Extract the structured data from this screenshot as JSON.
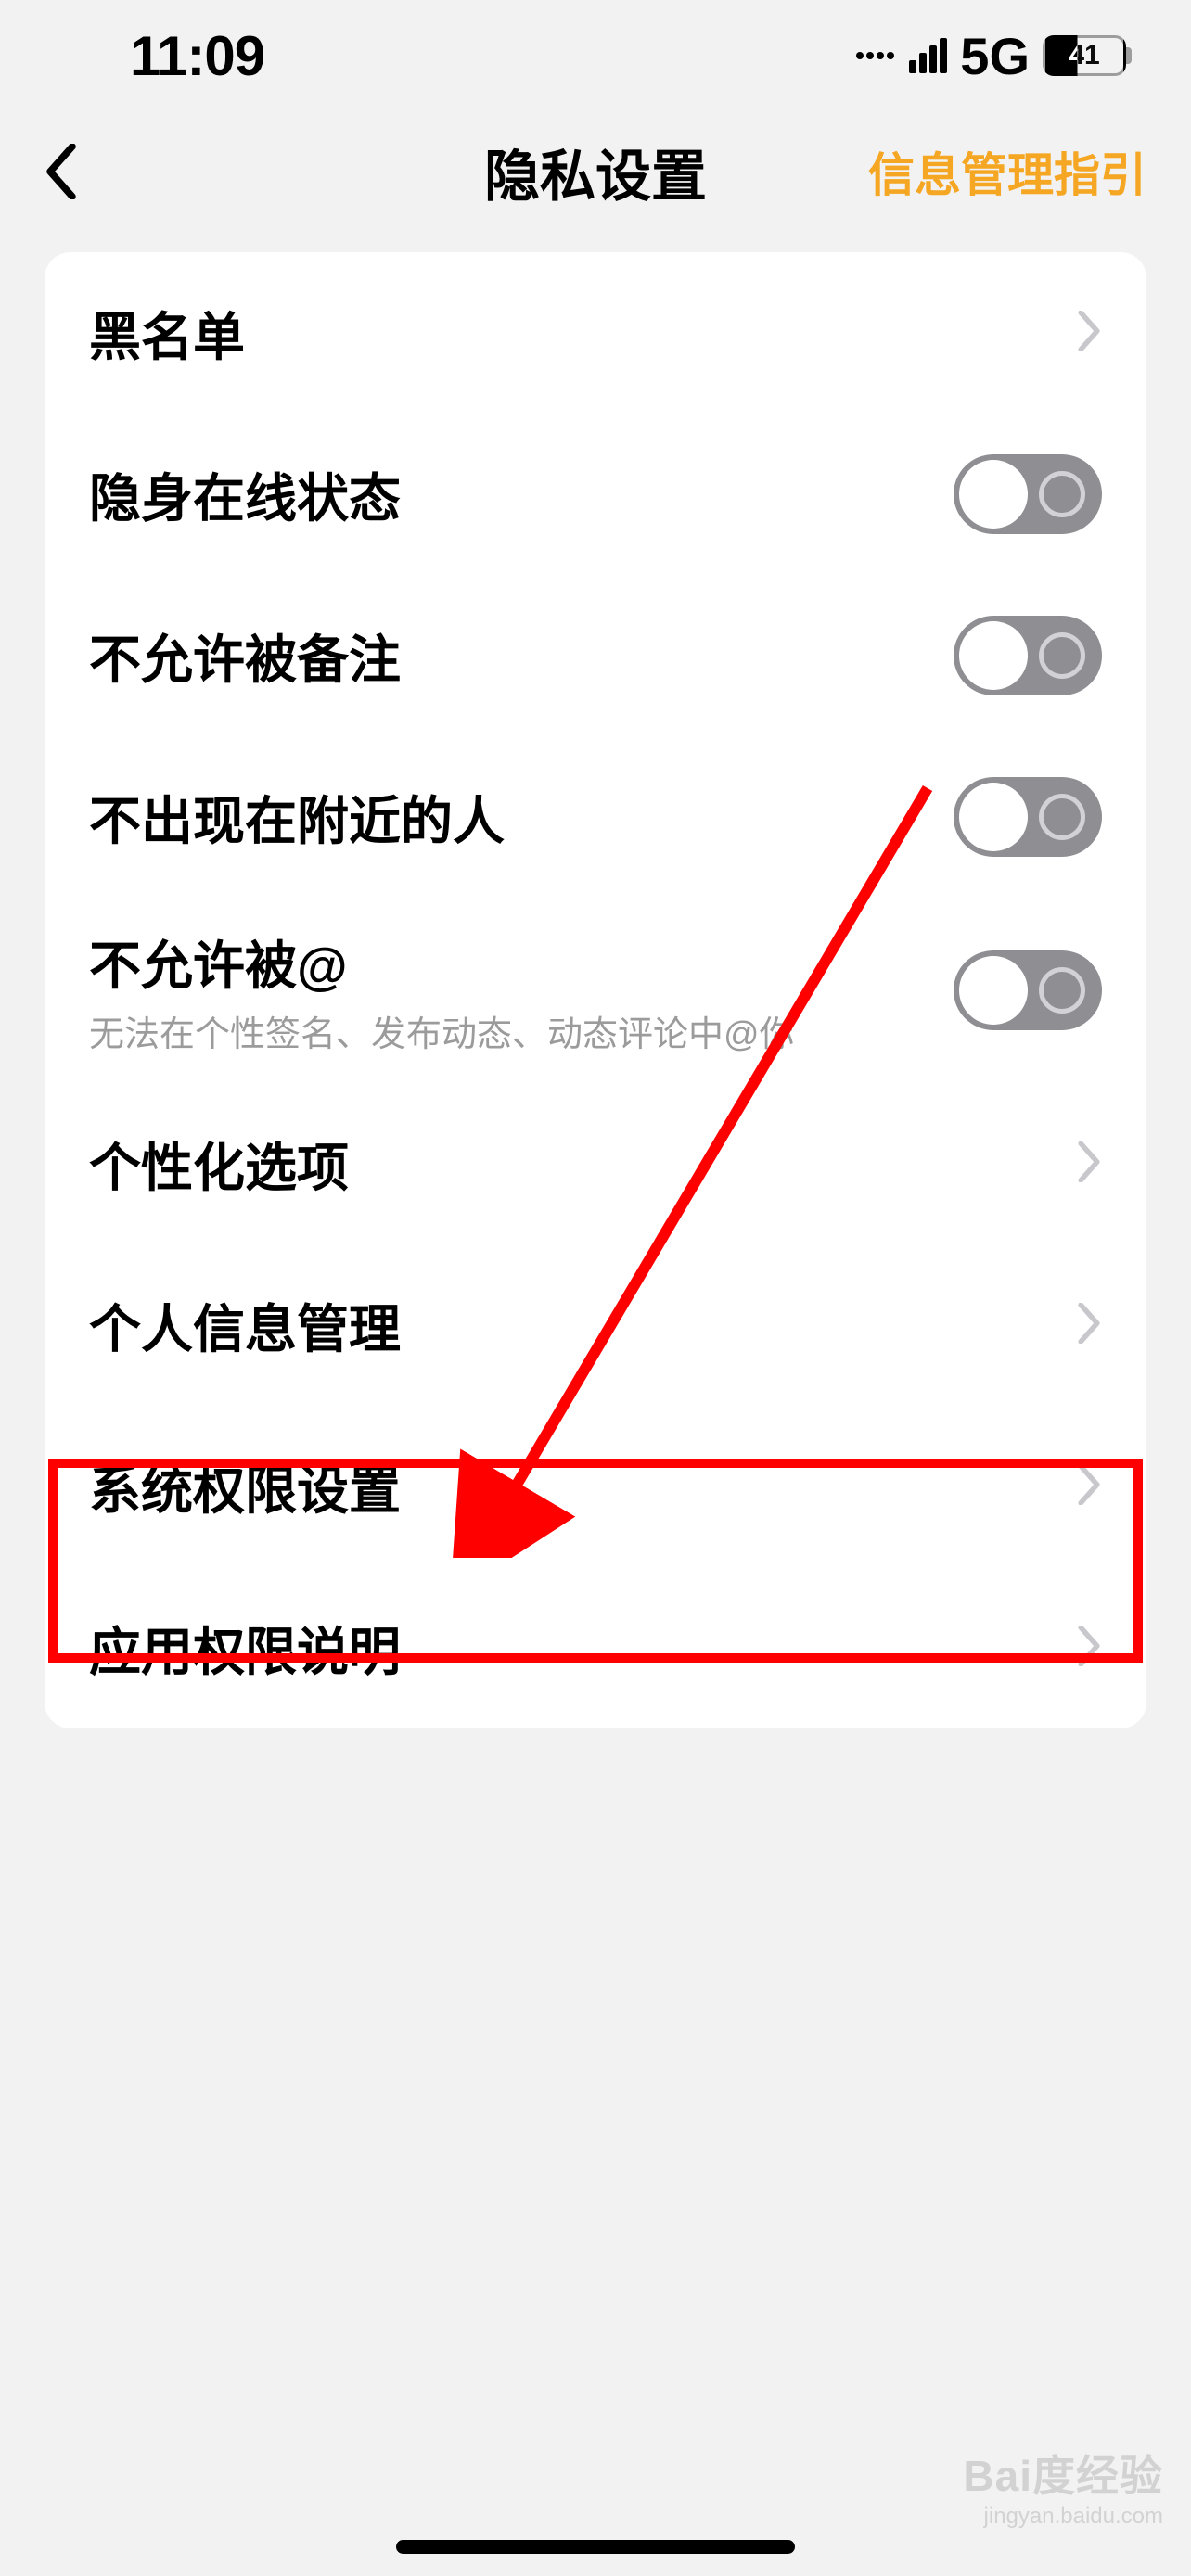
{
  "status": {
    "time": "11:09",
    "network": "5G",
    "battery": "41"
  },
  "header": {
    "title": "隐私设置",
    "right_link": "信息管理指引"
  },
  "rows": {
    "blacklist": "黑名单",
    "invisible_online": "隐身在线状态",
    "no_remark": "不允许被备注",
    "no_nearby": "不出现在附近的人",
    "no_at": {
      "label": "不允许被@",
      "sub": "无法在个性签名、发布动态、动态评论中@你"
    },
    "personalization": "个性化选项",
    "personal_info": "个人信息管理",
    "system_permission": "系统权限设置",
    "app_permission": "应用权限说明"
  },
  "watermark": {
    "main": "Bai度经验",
    "sub": "jingyan.baidu.com"
  }
}
